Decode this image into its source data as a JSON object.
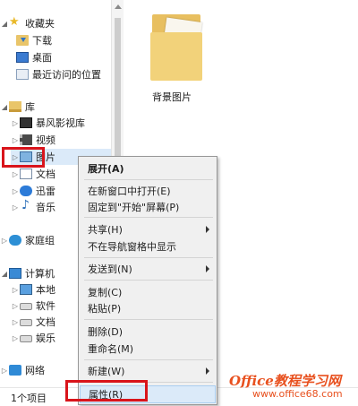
{
  "nav": {
    "items": [
      {
        "icon": "star-icon",
        "label": "收藏夹",
        "expander": "◢"
      },
      {
        "icon": "downloads-folder-icon",
        "label": "下载",
        "expander": ""
      },
      {
        "icon": "desktop-icon",
        "label": "桌面",
        "expander": ""
      },
      {
        "icon": "recent-places-icon",
        "label": "最近访问的位置",
        "expander": ""
      },
      {
        "icon": "library-icon",
        "label": "库",
        "expander": "◢"
      },
      {
        "icon": "video-library-icon",
        "label": "暴风影视库",
        "expander": "▷"
      },
      {
        "icon": "video-icon",
        "label": "视频",
        "expander": "▷"
      },
      {
        "icon": "pictures-icon",
        "label": "图片",
        "expander": "▷"
      },
      {
        "icon": "documents-icon",
        "label": "文档",
        "expander": "▷"
      },
      {
        "icon": "thunder-icon",
        "label": "迅雷",
        "expander": "▷"
      },
      {
        "icon": "music-icon",
        "label": "音乐",
        "expander": "▷"
      },
      {
        "icon": "homegroup-icon",
        "label": "家庭组",
        "expander": "▷"
      },
      {
        "icon": "computer-icon",
        "label": "计算机",
        "expander": "◢"
      },
      {
        "icon": "system-drive-icon",
        "label": "本地",
        "expander": "▷"
      },
      {
        "icon": "drive-icon",
        "label": "软件",
        "expander": "▷"
      },
      {
        "icon": "drive-icon",
        "label": "文档",
        "expander": "▷"
      },
      {
        "icon": "drive-icon",
        "label": "娱乐",
        "expander": "▷"
      },
      {
        "icon": "network-icon",
        "label": "网络",
        "expander": "▷"
      }
    ]
  },
  "status": {
    "text": "1个项目"
  },
  "content": {
    "folder_label": "背景图片"
  },
  "context_menu": {
    "items": [
      {
        "label": "展开(A)",
        "bold": true,
        "submenu": false
      },
      {
        "label": "在新窗口中打开(E)",
        "bold": false,
        "submenu": false
      },
      {
        "label": "固定到\"开始\"屏幕(P)",
        "bold": false,
        "submenu": false
      },
      {
        "label": "共享(H)",
        "bold": false,
        "submenu": true
      },
      {
        "label": "不在导航窗格中显示",
        "bold": false,
        "submenu": false
      },
      {
        "label": "发送到(N)",
        "bold": false,
        "submenu": true
      },
      {
        "label": "复制(C)",
        "bold": false,
        "submenu": false
      },
      {
        "label": "粘贴(P)",
        "bold": false,
        "submenu": false
      },
      {
        "label": "删除(D)",
        "bold": false,
        "submenu": false
      },
      {
        "label": "重命名(M)",
        "bold": false,
        "submenu": false
      },
      {
        "label": "新建(W)",
        "bold": false,
        "submenu": true
      },
      {
        "label": "属性(R)",
        "bold": false,
        "submenu": false
      }
    ]
  },
  "watermark": {
    "line1": "Office教程学习网",
    "line2": "www.office68.com"
  },
  "colors": {
    "highlight_box": "#d9141b",
    "menu_bg": "#f0f0f0",
    "hover_bg": "#dbeaf9"
  }
}
